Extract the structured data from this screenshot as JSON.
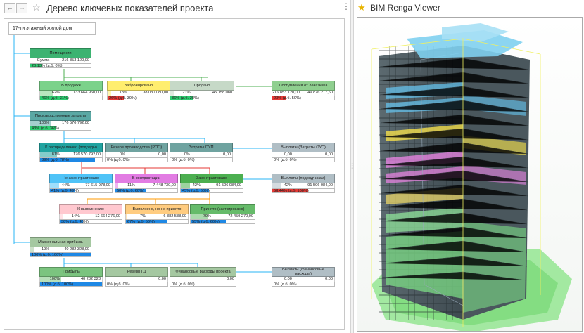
{
  "left_panel": {
    "title": "Дерево ключевых показателей проекта",
    "back_icon": "←",
    "forward_icon": "→",
    "star_icon": "☆",
    "menu_icon": "⋮"
  },
  "right_panel": {
    "title": "BIM Renga Viewer",
    "star_icon": "★"
  },
  "tree": {
    "root": "17-ти этажный жилой дом",
    "nodes": {
      "pomescheniya": {
        "label": "Помещения",
        "pct": "Сумма",
        "amt": "216 853 120,00",
        "fill": 0,
        "bar": "20,13% (д.б. 0%)",
        "bar_fill": 0.2,
        "color": "#3cb371",
        "bar_color": "#2ecc71"
      },
      "v_prodazhe": {
        "label": "В продаже",
        "pct": "62%",
        "amt": "133 664 960,00",
        "fill": 0.62,
        "bar": "46% (д.б. 31%)",
        "bar_fill": 0.46,
        "color": "#7bd28a",
        "bar_color": "#2ecc71"
      },
      "zabronirovano": {
        "label": "Забронировано",
        "pct": "18%",
        "amt": "38 030 080,00",
        "fill": 0.18,
        "bar": "26% (д.б. 39%)",
        "bar_fill": 0.26,
        "color": "#ffee6e",
        "bar_color": "#e53935"
      },
      "prodano": {
        "label": "Продано",
        "pct": "21%",
        "amt": "45 158 080",
        "fill": 0.21,
        "bar": "36% (д.б. 28%)",
        "bar_fill": 0.36,
        "color": "#c6d9c7",
        "bar_color": "#2ecc71"
      },
      "postupleniya": {
        "label": "Поступления от Заказчика",
        "pct": "216 853 120,00",
        "amt": "49 876 217,60",
        "fill": 0,
        "bar": "23% (д.б. 50%)",
        "bar_fill": 0.23,
        "color": "#8fcf8f",
        "bar_color": "#e53935"
      },
      "proizv_zatraty": {
        "label": "Производственные затраты",
        "pct": "100%",
        "amt": "176 570 792,00",
        "fill": 1,
        "bar": "43% (д.б. 36%)",
        "bar_fill": 0.43,
        "color": "#5aa8a4",
        "bar_color": "#2ecc71"
      },
      "k_raspred": {
        "label": "К распределению (подряды)",
        "pct": "81%",
        "amt": "176 570 792,00",
        "fill": 0.81,
        "bar": "89% (д.б. 78%)",
        "bar_fill": 0.89,
        "color": "#21a3a0",
        "bar_color": "#1e88e5"
      },
      "rezerv_proizv": {
        "label": "Резерв производства (РПО)",
        "pct": "0%",
        "amt": "0,00",
        "fill": 0,
        "bar": "0% (д.б. 0%)",
        "bar_fill": 0,
        "color": "#6fa3a0",
        "bar_color": "#1e88e5"
      },
      "zatraty_oup": {
        "label": "Затраты ОУП",
        "pct": "0%",
        "amt": "0,00",
        "fill": 0,
        "bar": "0% (д.б. 0%)",
        "bar_fill": 0,
        "color": "#6fa3a0",
        "bar_color": "#1e88e5"
      },
      "vyplaty_oup": {
        "label": "Выплаты (Затраты ОУП)",
        "pct": "0,00",
        "amt": "0,00",
        "fill": 0,
        "bar": "0% (д.б. 0%)",
        "bar_fill": 0,
        "color": "#b0bec5",
        "bar_color": "#1e88e5"
      },
      "ne_kontr": {
        "label": "Не законтрактовано",
        "pct": "44%",
        "amt": "77 615 978,00",
        "fill": 0.44,
        "bar": "41% (д.б. 49%)",
        "bar_fill": 0.41,
        "color": "#4fc3f7",
        "bar_color": "#1e88e5"
      },
      "v_kontraktacii": {
        "label": "В контрактации",
        "pct": "11%",
        "amt": "7 448 730,00",
        "fill": 0.11,
        "bar": "50% (д.б. 60%)",
        "bar_fill": 0.5,
        "color": "#e27ce3",
        "bar_color": "#1e88e5"
      },
      "zakontr": {
        "label": "Законтрактовано",
        "pct": "42%",
        "amt": "91 506 084,00",
        "fill": 0.42,
        "bar": "45% (д.б. 60%)",
        "bar_fill": 0.45,
        "color": "#4caf50",
        "bar_color": "#1e88e5"
      },
      "vyplaty_podr": {
        "label": "Выплаты (подрядчикам)",
        "pct": "42%",
        "amt": "91 506 084,00",
        "fill": 0.42,
        "bar": "58,44% (д.б. 100%)",
        "bar_fill": 0.58,
        "color": "#b0bec5",
        "bar_color": "#e53935"
      },
      "k_vypolneniyu": {
        "label": "К выполнению",
        "pct": "14%",
        "amt": "12 664 276,00",
        "fill": 0.14,
        "bar": "38% (д.б. 40%)",
        "bar_fill": 0.38,
        "color": "#ffc8cf",
        "bar_color": "#1e88e5"
      },
      "vyp_ne_prinyato": {
        "label": "Выполнено, но не принято",
        "pct": "7%",
        "amt": "6 382 538,00",
        "fill": 0.07,
        "bar": "67% (д.б. 50%)",
        "bar_fill": 0.67,
        "color": "#ffcc80",
        "bar_color": "#1e88e5"
      },
      "prinyato": {
        "label": "Принято (закткировано)",
        "pct": "79%",
        "amt": "72 459 270,00",
        "fill": 0.79,
        "bar": "55% (д.б. 60%)",
        "bar_fill": 0.55,
        "color": "#66bb6a",
        "bar_color": "#1e88e5"
      },
      "marzh": {
        "label": "Маржинальная прибыль",
        "pct": "19%",
        "amt": "40 282 328,00",
        "fill": 0.19,
        "bar": "100% (д.б. 100%)",
        "bar_fill": 1,
        "color": "#a5c8a1",
        "bar_color": "#1e88e5"
      },
      "pribyl": {
        "label": "Прибыль",
        "pct": "100%",
        "amt": "40 282 328",
        "fill": 1,
        "bar": "100% (д.б. 100%)",
        "bar_fill": 1,
        "color": "#7bc47f",
        "bar_color": "#1e88e5"
      },
      "rezerv_gd": {
        "label": "Резерв ГД",
        "pct": "",
        "amt": "0,00",
        "fill": 0,
        "bar": "0% (д.б. 0%)",
        "bar_fill": 0,
        "color": "#a5c8a1",
        "bar_color": "#1e88e5"
      },
      "fin_rashody": {
        "label": "Финансовые расходы проекта",
        "pct": "",
        "amt": "0,00",
        "fill": 0,
        "bar": "0% (д.б. 0%)",
        "bar_fill": 0,
        "color": "#a5c8a1",
        "bar_color": "#1e88e5"
      },
      "vyplaty_fin": {
        "label": "Выплаты (финансовые расходы)",
        "pct": "0,00",
        "amt": "0,00",
        "fill": 0,
        "bar": "0% (д.б. 0%)",
        "bar_fill": 0,
        "color": "#b0bec5",
        "bar_color": "#1e88e5"
      }
    }
  }
}
